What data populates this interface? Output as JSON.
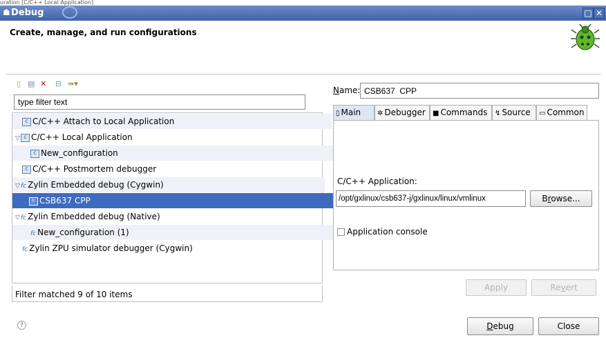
{
  "window": {
    "behind_caption": "uration [C/C++ Local Application]",
    "title": "Debug",
    "title_icon": "bug-small-icon",
    "controls": [
      "□",
      "✕"
    ]
  },
  "header": {
    "title": "Create, manage, and run configurations",
    "icon": "bug-icon"
  },
  "toolbar": {
    "icons": [
      "new-config-icon",
      "duplicate-icon",
      "delete-icon",
      "collapse-all-icon",
      "filter-dropdown-icon"
    ]
  },
  "filter": {
    "value": "type filter text"
  },
  "tree": {
    "items": [
      {
        "label": "C/C++ Attach to Local Application",
        "level": 0,
        "expanded": null,
        "icon": "c-config-icon",
        "selected": false
      },
      {
        "label": "C/C++ Local Application",
        "level": 0,
        "expanded": true,
        "icon": "c-config-icon",
        "selected": false
      },
      {
        "label": "New_configuration",
        "level": 1,
        "expanded": null,
        "icon": "c-config-icon",
        "selected": false
      },
      {
        "label": "C/C++ Postmortem debugger",
        "level": 0,
        "expanded": null,
        "icon": "c-config-icon",
        "selected": false
      },
      {
        "label": "Zylin Embedded debug (Cygwin)",
        "level": 0,
        "expanded": true,
        "icon": "zylin-icon",
        "selected": false
      },
      {
        "label": "CSB637 CPP",
        "level": 1,
        "expanded": null,
        "icon": "zylin-config-icon",
        "selected": true
      },
      {
        "label": "Zylin Embedded debug (Native)",
        "level": 0,
        "expanded": true,
        "icon": "zylin-icon",
        "selected": false
      },
      {
        "label": "New_configuration (1)",
        "level": 1,
        "expanded": null,
        "icon": "zylin-icon",
        "selected": false
      },
      {
        "label": "Zylin ZPU simulator debugger (Cygwin)",
        "level": 0,
        "expanded": null,
        "icon": "zylin-icon",
        "selected": false
      }
    ],
    "status": "Filter matched 9 of 10 items"
  },
  "config": {
    "name_label": "Name:",
    "name_value": "CSB637  CPP",
    "tabs": [
      {
        "label": "Main",
        "icon": "main-tab-icon",
        "active": true
      },
      {
        "label": "Debugger",
        "icon": "debugger-tab-icon",
        "active": false
      },
      {
        "label": "Commands",
        "icon": "commands-tab-icon",
        "active": false
      },
      {
        "label": "Source",
        "icon": "source-tab-icon",
        "active": false
      },
      {
        "label": "Common",
        "icon": "common-tab-icon",
        "active": false
      }
    ],
    "app_label": "C/C++ Application:",
    "app_value": "/opt/gxlinux/csb637-j/gxlinux/linux/vmlinux",
    "browse_label": "Browse...",
    "console_label": "Application console",
    "console_checked": false,
    "apply_label": "Apply",
    "revert_label": "Revert"
  },
  "footer": {
    "help_icon": "help-icon",
    "debug_label": "Debug",
    "close_label": "Close"
  }
}
